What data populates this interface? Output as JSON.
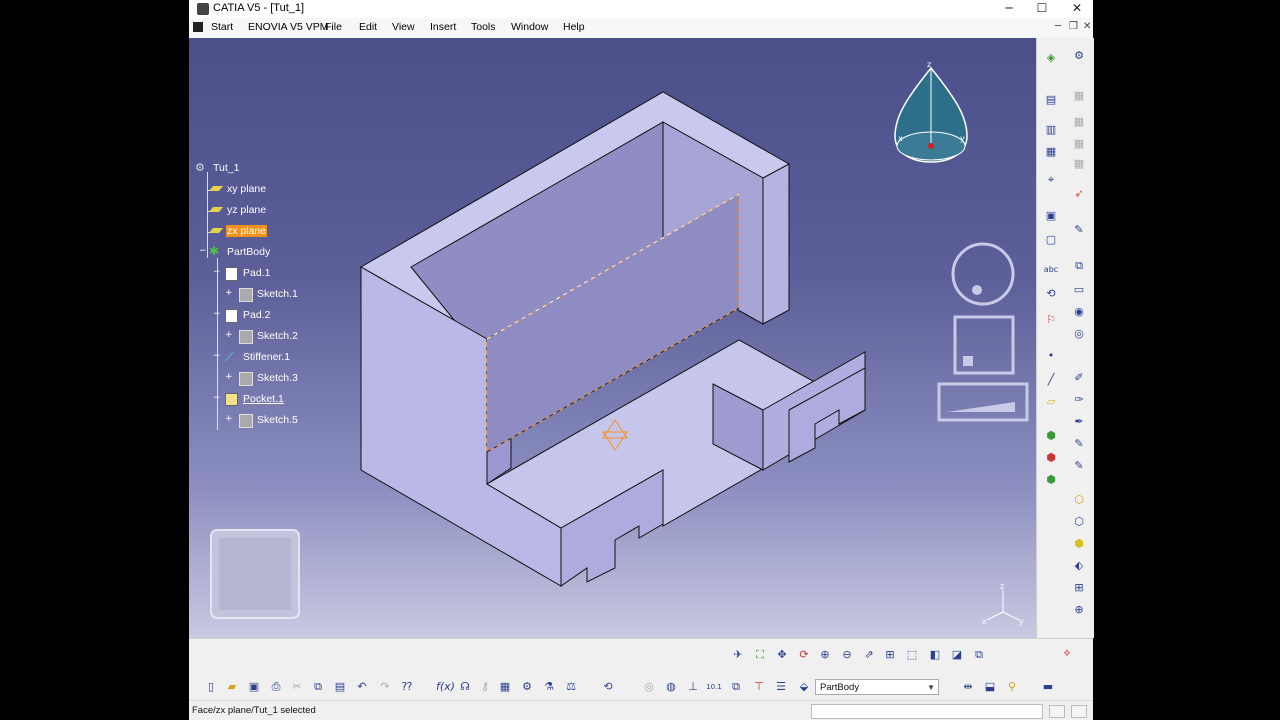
{
  "window": {
    "title": "CATIA V5 - [Tut_1]",
    "controls": {
      "minimize": "─",
      "maximize": "☐",
      "close": "✕"
    }
  },
  "menubar": {
    "items": [
      "Start",
      "ENOVIA V5 VPM",
      "File",
      "Edit",
      "View",
      "Insert",
      "Tools",
      "Window",
      "Help"
    ],
    "mdi_controls": {
      "minimize": "─",
      "restore": "❐",
      "close": "✕"
    }
  },
  "tree": {
    "root": "Tut_1",
    "nodes": [
      {
        "label": "xy plane",
        "type": "plane",
        "selected": false
      },
      {
        "label": "yz plane",
        "type": "plane",
        "selected": false
      },
      {
        "label": "zx plane",
        "type": "plane",
        "selected": true
      },
      {
        "label": "PartBody",
        "type": "body"
      },
      {
        "label": "Pad.1",
        "type": "feature"
      },
      {
        "label": "Sketch.1",
        "type": "sketch"
      },
      {
        "label": "Pad.2",
        "type": "feature"
      },
      {
        "label": "Sketch.2",
        "type": "sketch"
      },
      {
        "label": "Stiffener.1",
        "type": "feature"
      },
      {
        "label": "Sketch.3",
        "type": "sketch"
      },
      {
        "label": "Pocket.1",
        "type": "feature"
      },
      {
        "label": "Sketch.5",
        "type": "sketch"
      }
    ]
  },
  "compass": {
    "axis_z": "z",
    "axis_x": "x",
    "axis_y": "y"
  },
  "axis_triad": {
    "z": "z",
    "x": "x",
    "y": "y"
  },
  "bottom_toolbar": {
    "body_select": "PartBody"
  },
  "status": {
    "message": "Face/zx plane/Tut_1 selected"
  },
  "colors": {
    "viewport_top": "#4b4f8a",
    "viewport_bottom": "#c9c9e2",
    "selection": "#f5921e",
    "part_face": "#b9b8e6",
    "part_shade": "#8c8ac0"
  }
}
